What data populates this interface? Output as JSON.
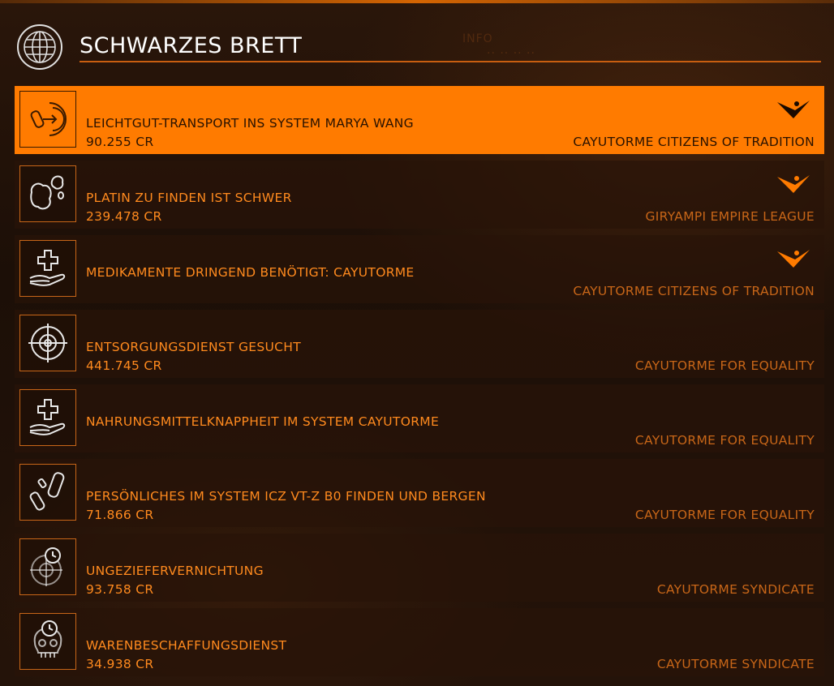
{
  "header": {
    "title": "SCHWARZES BRETT",
    "icon": "globe-icon"
  },
  "colors": {
    "accent": "#ff7b00",
    "text": "#ff8a1e",
    "faction": "#c86618",
    "selected_text": "#2a1200"
  },
  "missions": [
    {
      "icon": "cargo-delivery-icon",
      "title": "LEICHTGUT-TRANSPORT INS SYSTEM MARYA WANG",
      "reward": "90.255 CR",
      "faction": "CAYUTORME CITIZENS OF TRADITION",
      "rank_icon": true,
      "selected": true
    },
    {
      "icon": "asteroid-icon",
      "title": "PLATIN ZU FINDEN IST SCHWER",
      "reward": "239.478 CR",
      "faction": "GIRYAMPI EMPIRE LEAGUE",
      "rank_icon": true,
      "selected": false
    },
    {
      "icon": "medical-aid-icon",
      "title": "MEDIKAMENTE DRINGEND BENÖTIGT: CAYUTORME",
      "reward": "",
      "faction": "CAYUTORME CITIZENS OF TRADITION",
      "rank_icon": true,
      "selected": false
    },
    {
      "icon": "crosshair-icon",
      "title": "ENTSORGUNGSDIENST GESUCHT",
      "reward": "441.745 CR",
      "faction": "CAYUTORME FOR EQUALITY",
      "rank_icon": false,
      "selected": false
    },
    {
      "icon": "medical-aid-icon",
      "title": "NAHRUNGSMITTELKNAPPHEIT IM SYSTEM CAYUTORME",
      "reward": "",
      "faction": "CAYUTORME FOR EQUALITY",
      "rank_icon": false,
      "selected": false
    },
    {
      "icon": "salvage-canisters-icon",
      "title": "PERSÖNLICHES IM SYSTEM ICZ VT-Z B0 FINDEN UND BERGEN",
      "reward": "71.866 CR",
      "faction": "CAYUTORME FOR EQUALITY",
      "rank_icon": false,
      "selected": false
    },
    {
      "icon": "timed-crosshair-icon",
      "title": "UNGEZIEFERVERNICHTUNG",
      "reward": "93.758 CR",
      "faction": "CAYUTORME SYNDICATE",
      "rank_icon": false,
      "selected": false
    },
    {
      "icon": "timed-skull-icon",
      "title": "WARENBESCHAFFUNGSDIENST",
      "reward": "34.938 CR",
      "faction": "CAYUTORME SYNDICATE",
      "rank_icon": false,
      "selected": false
    }
  ]
}
